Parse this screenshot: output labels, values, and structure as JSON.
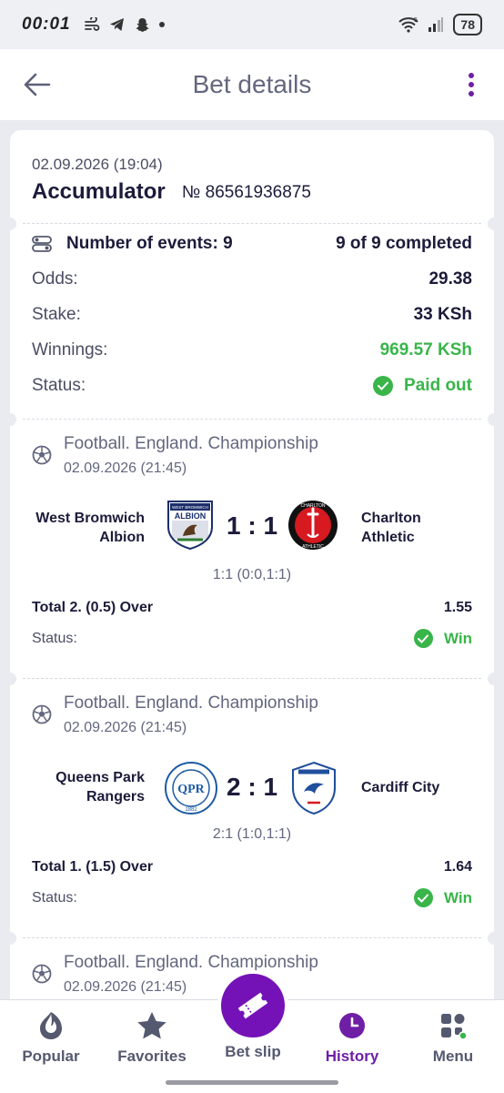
{
  "status_bar": {
    "time": "00:01",
    "battery": "78",
    "signal_badge": "5"
  },
  "header": {
    "title": "Bet details"
  },
  "summary": {
    "date": "02.09.2026 (19:04)",
    "type": "Accumulator",
    "number": "№ 86561936875",
    "events_label": "Number of events: 9",
    "events_completed": "9 of 9 completed",
    "odds_label": "Odds:",
    "odds_value": "29.38",
    "stake_label": "Stake:",
    "stake_value": "33 KSh",
    "winnings_label": "Winnings:",
    "winnings_value": "969.57 KSh",
    "status_label": "Status:",
    "status_value": "Paid out"
  },
  "events": [
    {
      "league": "Football. England. Championship",
      "date": "02.09.2026 (21:45)",
      "home_line1": "West Bromwich",
      "home_line2": "Albion",
      "away_line1": "Charlton",
      "away_line2": "Athletic",
      "score": "1 : 1",
      "halftime": "1:1 (0:0,1:1)",
      "pick": "Total 2. (0.5) Over",
      "odds": "1.55",
      "status_label": "Status:",
      "result": "Win",
      "home_logo_text": "WEST BROMWICH",
      "home_logo_word": "ALBION",
      "away_logo_word": "CHARLTON",
      "away_logo_word2": "ATHLETIC"
    },
    {
      "league": "Football. England. Championship",
      "date": "02.09.2026 (21:45)",
      "home_line1": "Queens Park",
      "home_line2": "Rangers",
      "away_line1": "Cardiff City",
      "away_line2": "",
      "score": "2 : 1",
      "halftime": "2:1 (1:0,1:1)",
      "pick": "Total 1. (1.5) Over",
      "odds": "1.64",
      "status_label": "Status:",
      "result": "Win",
      "home_logo_text": "QPR",
      "home_logo_year": "1882"
    },
    {
      "league": "Football. England. Championship",
      "date": "02.09.2026 (21:45)"
    }
  ],
  "nav": {
    "popular": "Popular",
    "favorites": "Favorites",
    "betslip": "Bet slip",
    "history": "History",
    "menu": "Menu"
  },
  "colors": {
    "accent": "#7412b7",
    "win": "#39b54a",
    "text": "#1c1b3a",
    "muted": "#63677f"
  }
}
